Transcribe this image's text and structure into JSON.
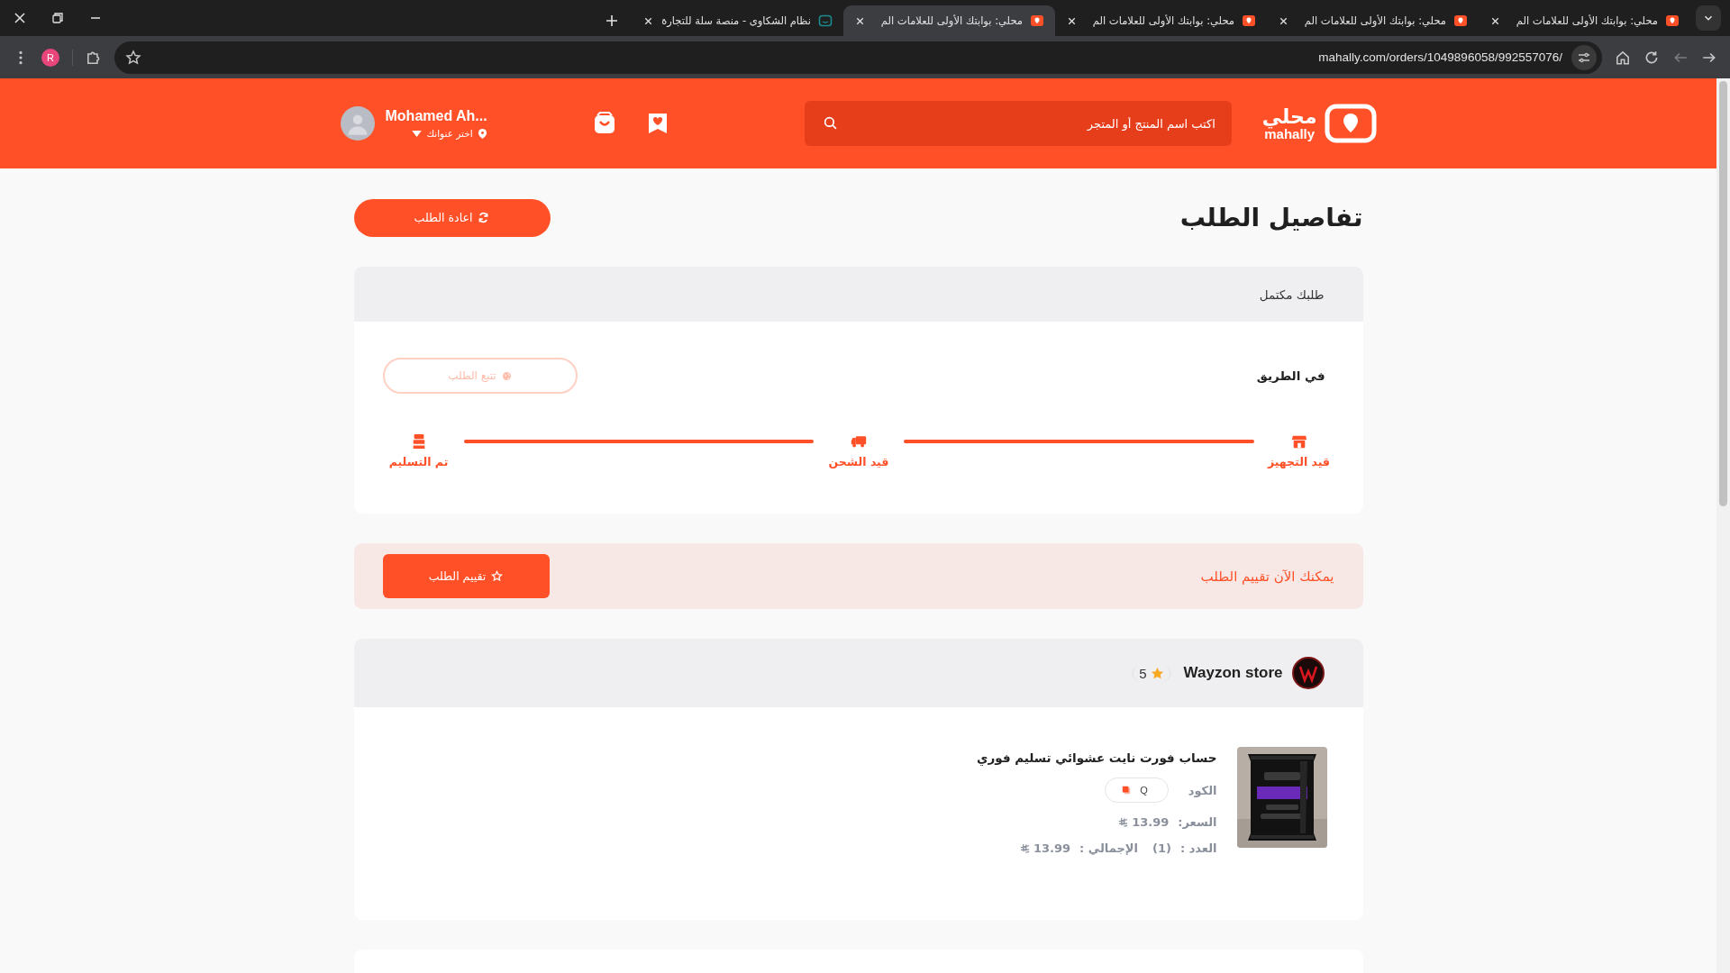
{
  "browser": {
    "tabs": [
      {
        "title": "محلي: بوابتك الأولى للعلامات الم",
        "kind": "mahally",
        "selected": false
      },
      {
        "title": "محلي: بوابتك الأولى للعلامات الم",
        "kind": "mahally",
        "selected": false
      },
      {
        "title": "محلي: بوابتك الأولى للعلامات الم",
        "kind": "mahally",
        "selected": false
      },
      {
        "title": "محلي: بوابتك الأولى للعلامات الم",
        "kind": "mahally",
        "selected": true
      },
      {
        "title": "نظام الشكاوى - منصة سلة للتجارة",
        "kind": "salla",
        "selected": false
      }
    ],
    "url": "mahally.com/orders/1049896058/992557076/",
    "profile_initial": "R"
  },
  "header": {
    "logo_ar": "محلي",
    "logo_en": "mahally",
    "search": {
      "placeholder": "اكتب اسم المنتج أو المتجر"
    },
    "user": {
      "name": "Mohamed Ah...",
      "address": "اختر عنوانك"
    }
  },
  "page": {
    "title": "تفاصيل الطلب",
    "reorder_button": "اعادة الطلب"
  },
  "status_card": {
    "heading": "طلبك مكتمل",
    "current": "في الطريق",
    "track_button": {
      "label": "تتبع الطلب",
      "disabled": true
    },
    "steps": [
      {
        "label": "قيد التجهيز",
        "kind": "store",
        "done": true
      },
      {
        "label": "قيد الشحن",
        "kind": "truck",
        "done": true
      },
      {
        "label": "تم التسليم",
        "kind": "delivered",
        "done": true
      }
    ]
  },
  "rating_banner": {
    "text": "يمكنك الآن تقييم الطلب",
    "button": "تقييم الطلب"
  },
  "store": {
    "name": "Wayzon store",
    "rating": "5",
    "items": [
      {
        "title": "حساب فورت نايت عشوائي تسليم فوري",
        "code_label": "الكود",
        "code": "Q",
        "price_label": "السعر:",
        "price": "13.99",
        "quantity_label": "العدد :",
        "quantity": "(1)",
        "total_label": "الإجمالي :",
        "total": "13.99"
      }
    ]
  }
}
